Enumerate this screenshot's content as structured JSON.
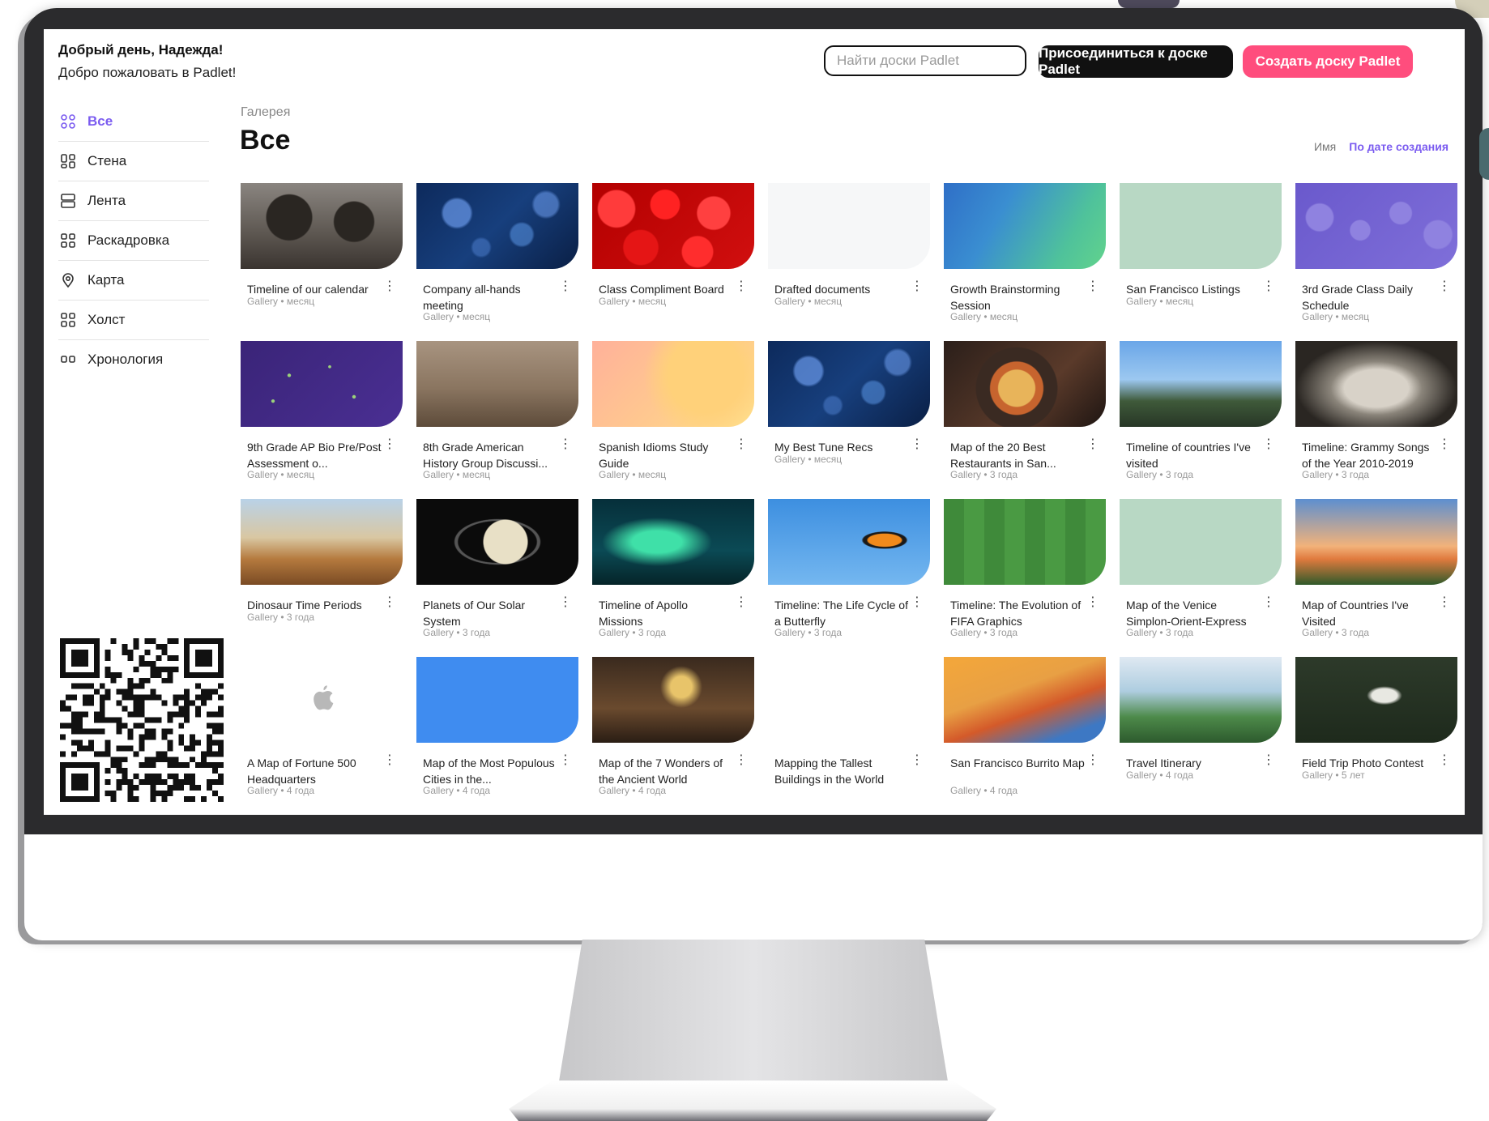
{
  "header": {
    "greeting": "Добрый день, Надежда!",
    "welcome": "Добро пожаловать в Padlet!",
    "search_placeholder": "Найти доски Padlet",
    "join_label": "Присоединиться к доске Padlet",
    "create_label": "Создать доску Padlet"
  },
  "sidebar": {
    "items": [
      {
        "label": "Все",
        "icon": "grid-icon",
        "active": true
      },
      {
        "label": "Стена",
        "icon": "wall-icon"
      },
      {
        "label": "Лента",
        "icon": "stream-icon"
      },
      {
        "label": "Раскадровка",
        "icon": "storyboard-icon"
      },
      {
        "label": "Карта",
        "icon": "map-pin-icon"
      },
      {
        "label": "Холст",
        "icon": "canvas-icon"
      },
      {
        "label": "Хронология",
        "icon": "timeline-icon"
      }
    ],
    "accent": "#7b5cf0"
  },
  "main": {
    "breadcrumb": "Галерея",
    "title": "Все",
    "sort": {
      "name_label": "Имя",
      "date_label": "По дате создания"
    }
  },
  "colors": {
    "primary_button": "#111111",
    "create_button": "#ff4d7d",
    "accent": "#7b5cf0"
  },
  "cards": [
    {
      "title": "Timeline of our calendar",
      "meta": "Gallery • месяц",
      "thumb": "colosseum"
    },
    {
      "title": "Company all-hands meeting",
      "meta": "Gallery • месяц",
      "thumb": "bokeh-blue"
    },
    {
      "title": "Class Compliment Board",
      "meta": "Gallery • месяц",
      "thumb": "roses"
    },
    {
      "title": "Drafted documents",
      "meta": "Gallery • месяц",
      "thumb": "blank-white"
    },
    {
      "title": "Growth Brainstorming Session",
      "meta": "Gallery • месяц",
      "thumb": "green-gradient"
    },
    {
      "title": "San Francisco Listings",
      "meta": "Gallery • месяц",
      "thumb": "mint"
    },
    {
      "title": "3rd Grade Class Daily Schedule",
      "meta": "Gallery • месяц",
      "thumb": "purple-faces"
    },
    {
      "title": "9th Grade AP Bio Pre/Post Assessment o...",
      "meta": "Gallery • месяц",
      "thumb": "purple-stars"
    },
    {
      "title": "8th Grade American History Group Discussi...",
      "meta": "Gallery • месяц",
      "thumb": "horses"
    },
    {
      "title": "Spanish Idioms Study Guide",
      "meta": "Gallery • месяц",
      "thumb": "peach"
    },
    {
      "title": "My Best Tune Recs",
      "meta": "Gallery • месяц",
      "thumb": "bokeh-blue"
    },
    {
      "title": "Map of the 20 Best Restaurants in San...",
      "meta": "Gallery • 3 года",
      "thumb": "food"
    },
    {
      "title": "Timeline of countries I've visited",
      "meta": "Gallery • 3 года",
      "thumb": "castle"
    },
    {
      "title": "Timeline: Grammy Songs of the Year 2010-2019",
      "meta": "Gallery • 3 года",
      "thumb": "face-bw"
    },
    {
      "title": "Dinosaur Time Periods",
      "meta": "Gallery • 3 года",
      "thumb": "dinosaurs"
    },
    {
      "title": "Planets of Our Solar System",
      "meta": "Gallery • 3 года",
      "thumb": "saturn"
    },
    {
      "title": "Timeline of Apollo Missions",
      "meta": "Gallery • 3 года",
      "thumb": "aurora"
    },
    {
      "title": "Timeline: The Life Cycle of a Butterfly",
      "meta": "Gallery • 3 года",
      "thumb": "butterfly"
    },
    {
      "title": "Timeline: The Evolution of FIFA Graphics",
      "meta": "Gallery • 3 года",
      "thumb": "football"
    },
    {
      "title": "Map of the Venice Simplon-Orient-Express",
      "meta": "Gallery • 3 года",
      "thumb": "mint"
    },
    {
      "title": "Map of Countries I've Visited",
      "meta": "Gallery • 3 года",
      "thumb": "eiffel"
    },
    {
      "title": "A Map of Fortune 500 Headquarters",
      "meta": "Gallery • 4 года",
      "thumb": "apple-logo"
    },
    {
      "title": "Map of the Most Populous Cities in the...",
      "meta": "Gallery • 4 года",
      "thumb": "blue-solid"
    },
    {
      "title": "Map of the 7 Wonders of the Ancient World",
      "meta": "Gallery • 4 года",
      "thumb": "zeus"
    },
    {
      "title": "Mapping the Tallest Buildings in the World",
      "meta": "",
      "thumb": "empty"
    },
    {
      "title": "San Francisco Burrito Map",
      "meta": "Gallery • 4 года",
      "thumb": "burrito"
    },
    {
      "title": "Travel Itinerary",
      "meta": "Gallery • 4 года",
      "thumb": "supertrees"
    },
    {
      "title": "Field Trip Photo Contest",
      "meta": "Gallery • 5 лет",
      "thumb": "statue"
    }
  ]
}
